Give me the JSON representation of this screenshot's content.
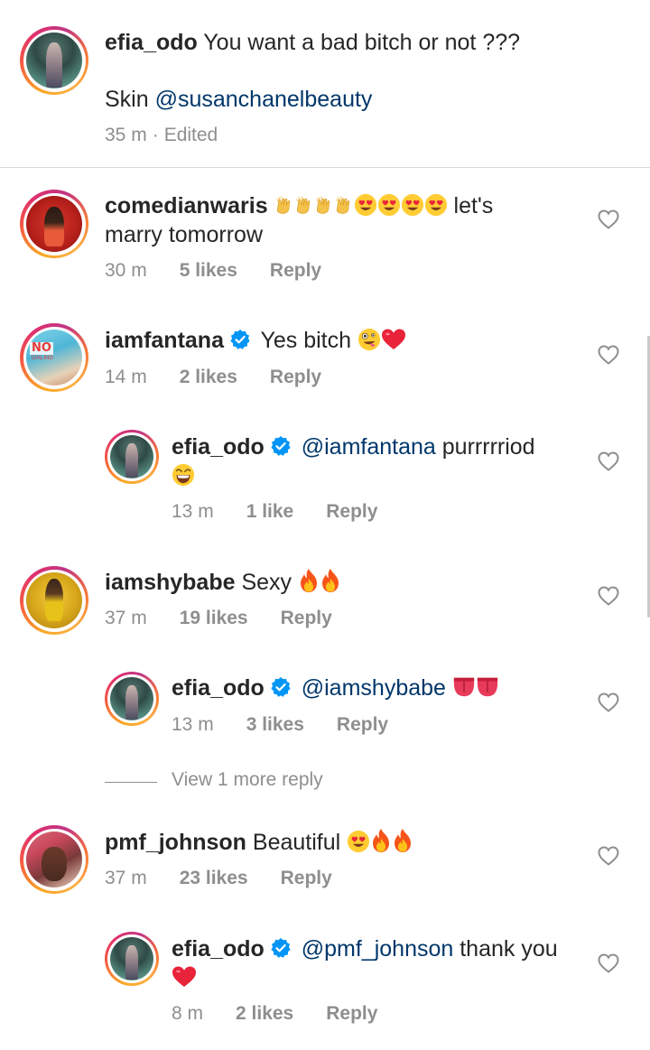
{
  "caption": {
    "username": "efia_odo",
    "text": "You want a bad bitch or not ???",
    "line2_prefix": "Skin ",
    "mention": "@susanchanelbeauty",
    "time": "35 m",
    "edited": "Edited"
  },
  "comments": [
    {
      "username": "comedianwaris",
      "text": "let's",
      "text_line2": "marry tomorrow",
      "time": "30 m",
      "likes": "5 likes",
      "reply": "Reply"
    },
    {
      "username": "iamfantana",
      "text": "Yes bitch",
      "time": "14 m",
      "likes": "2 likes",
      "reply": "Reply",
      "avatar_badge": "NO",
      "avatar_badge_sub": "DIALING"
    },
    {
      "username": "efia_odo",
      "mention": "@iamfantana",
      "text": "purrrrriod",
      "time": "13 m",
      "likes": "1 like",
      "reply": "Reply"
    },
    {
      "username": "iamshybabe",
      "text": "Sexy",
      "time": "37 m",
      "likes": "19 likes",
      "reply": "Reply"
    },
    {
      "username": "efia_odo",
      "mention": "@iamshybabe",
      "text": "",
      "time": "13 m",
      "likes": "3 likes",
      "reply": "Reply"
    },
    {
      "username": "pmf_johnson",
      "text": "Beautiful",
      "time": "37 m",
      "likes": "23 likes",
      "reply": "Reply"
    },
    {
      "username": "efia_odo",
      "mention": "@pmf_johnson",
      "text": "thank you",
      "time": "8 m",
      "likes": "2 likes",
      "reply": "Reply"
    }
  ],
  "view_more": "View 1 more reply",
  "colors": {
    "text": "#262626",
    "meta": "#8e8e8e",
    "mention": "#00376b",
    "verified": "#0095f6",
    "divider": "#dbdbdb"
  },
  "icons": [
    "heart-outline-icon",
    "verified-badge-icon",
    "raising-hands-emoji",
    "heart-eyes-emoji",
    "zany-face-emoji",
    "red-heart-emoji",
    "fire-emoji",
    "laughing-emoji",
    "tongue-emoji"
  ]
}
